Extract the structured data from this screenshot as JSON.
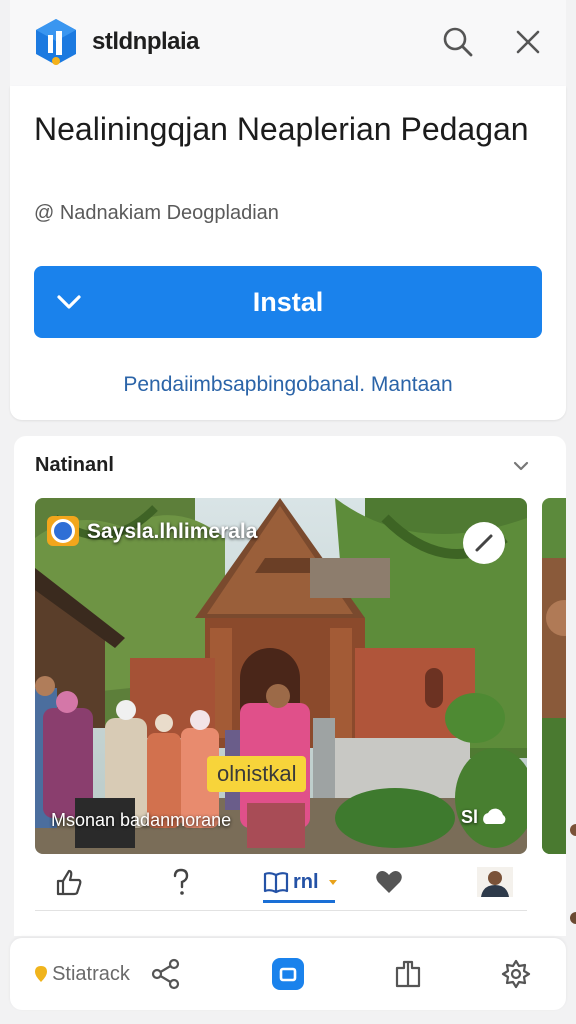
{
  "topbar": {
    "brand": "stldnplaia",
    "logo_icon": "store-logo-icon",
    "search_icon": "search-icon",
    "close_icon": "close-icon"
  },
  "app": {
    "title": "Nealiningqjan Neaplerian Pedagan",
    "publisher": "@ Nadnakiam Deogpladian",
    "install_label": "Instal",
    "promo_link": "Pendaiimbsapbingobanal. Mantaan"
  },
  "section": {
    "title": "Natinanl",
    "photo": {
      "caption_top": "Saysla.lhlimerala",
      "tag": "olnistkal",
      "caption_bottom": "Msonan badanmorane",
      "counter": "Sl"
    },
    "actions": {
      "tab_label": "rnl"
    }
  },
  "bottom_nav": {
    "items": [
      {
        "label": "Stiatrack",
        "icon": "home-pin-icon"
      },
      {
        "label": "",
        "icon": "share-icon"
      },
      {
        "label": "",
        "icon": "apps-icon"
      },
      {
        "label": "",
        "icon": "bookmark-icon"
      },
      {
        "label": "",
        "icon": "settings-icon"
      }
    ]
  },
  "colors": {
    "accent": "#1a82ec",
    "link": "#2b64a8",
    "tag": "#f7d43a"
  }
}
